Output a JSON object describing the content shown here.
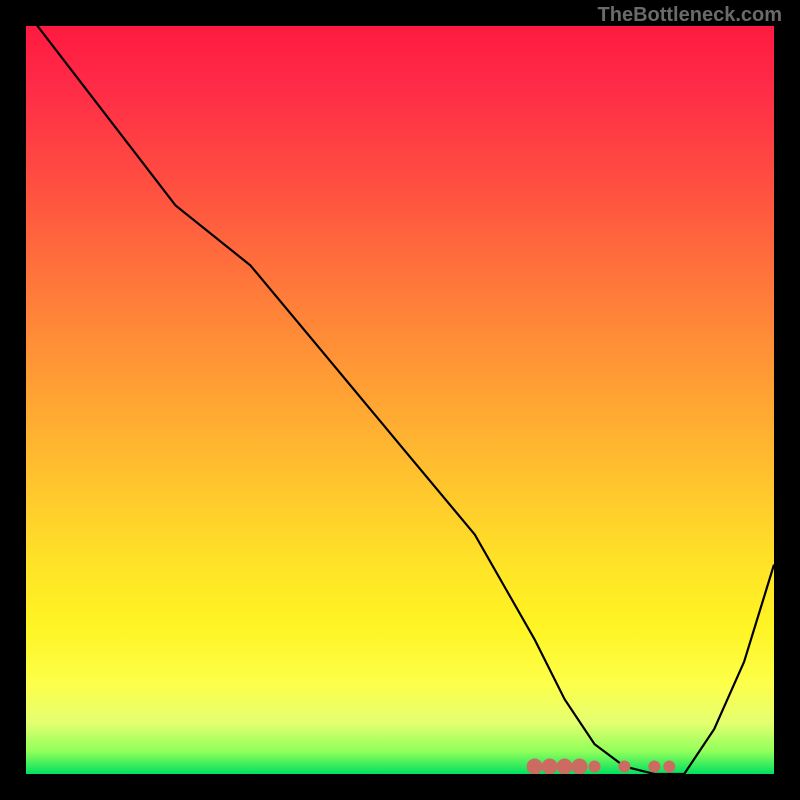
{
  "watermark": "TheBottleneck.com",
  "chart_data": {
    "type": "line",
    "title": "",
    "xlabel": "",
    "ylabel": "",
    "xlim": [
      0,
      100
    ],
    "ylim": [
      0,
      100
    ],
    "series": [
      {
        "name": "curve",
        "x": [
          0,
          10,
          20,
          30,
          40,
          50,
          60,
          68,
          72,
          76,
          80,
          84,
          88,
          92,
          96,
          100
        ],
        "y": [
          102,
          89,
          76,
          68,
          56,
          44,
          32,
          18,
          10,
          4,
          1,
          0,
          0,
          6,
          15,
          28
        ]
      }
    ],
    "markers": {
      "name": "highlight-dots",
      "x": [
        68,
        70,
        72,
        74,
        76,
        80,
        84,
        86
      ],
      "y": [
        1,
        1,
        1,
        1,
        1,
        1,
        1,
        1
      ]
    }
  }
}
